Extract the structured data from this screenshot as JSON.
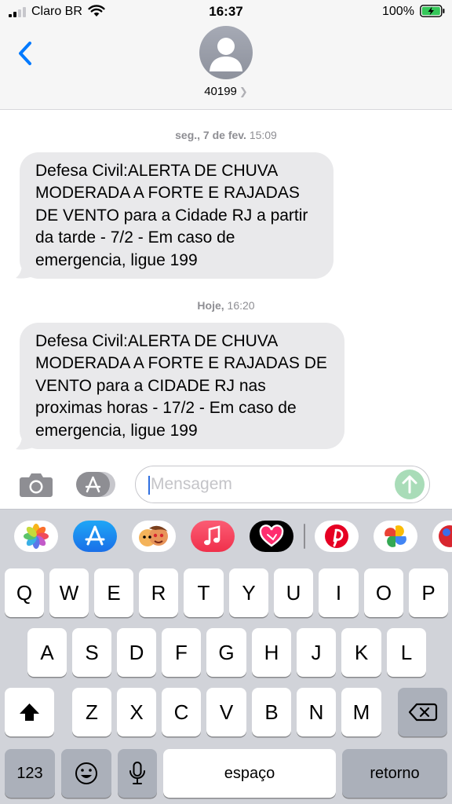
{
  "status_bar": {
    "carrier": "Claro BR",
    "time": "16:37",
    "battery_percent": "100%",
    "signal_bars": 2,
    "battery_level": 1.0,
    "battery_charging": true
  },
  "header": {
    "contact": "40199",
    "back_icon": "chevron-left-icon",
    "avatar_icon": "person-silhouette-icon"
  },
  "conversation": {
    "messages": [
      {
        "day": "seg., 7 de fev.",
        "time": "15:09",
        "text": "Defesa Civil:ALERTA DE CHUVA MODERADA A FORTE E RAJADAS DE VENTO para a Cidade RJ a partir da tarde - 7/2 - Em caso de emergencia, ligue 199"
      },
      {
        "day": "Hoje,",
        "time": "16:20",
        "text": "Defesa Civil:ALERTA DE CHUVA MODERADA A FORTE E RAJADAS DE VENTO para a CIDADE RJ nas proximas horas - 17/2 - Em caso de emergencia, ligue 199"
      }
    ]
  },
  "compose": {
    "placeholder": "Mensagem",
    "camera_icon": "camera-icon",
    "apps_icon": "app-store-icon",
    "send_icon": "arrow-up-icon"
  },
  "app_drawer": {
    "apps": [
      "photos-icon",
      "app-store-icon",
      "memoji-icon",
      "music-icon",
      "digital-touch-icon",
      "pinterest-icon",
      "google-photos-icon",
      "sticker-icon"
    ]
  },
  "keyboard": {
    "row1": [
      "Q",
      "W",
      "E",
      "R",
      "T",
      "Y",
      "U",
      "I",
      "O",
      "P"
    ],
    "row2": [
      "A",
      "S",
      "D",
      "F",
      "G",
      "H",
      "J",
      "K",
      "L"
    ],
    "row3": [
      "Z",
      "X",
      "C",
      "V",
      "B",
      "N",
      "M"
    ],
    "numbers_key": "123",
    "space_key": "espaço",
    "return_key": "retorno",
    "shift_icon": "shift-icon",
    "delete_icon": "backspace-icon",
    "emoji_icon": "emoji-icon",
    "mic_icon": "microphone-icon"
  },
  "colors": {
    "accent": "#007aff",
    "bubble_received": "#e9e9eb",
    "keyboard_bg": "#d1d3d9",
    "send_disabled": "#a9dcb8"
  }
}
